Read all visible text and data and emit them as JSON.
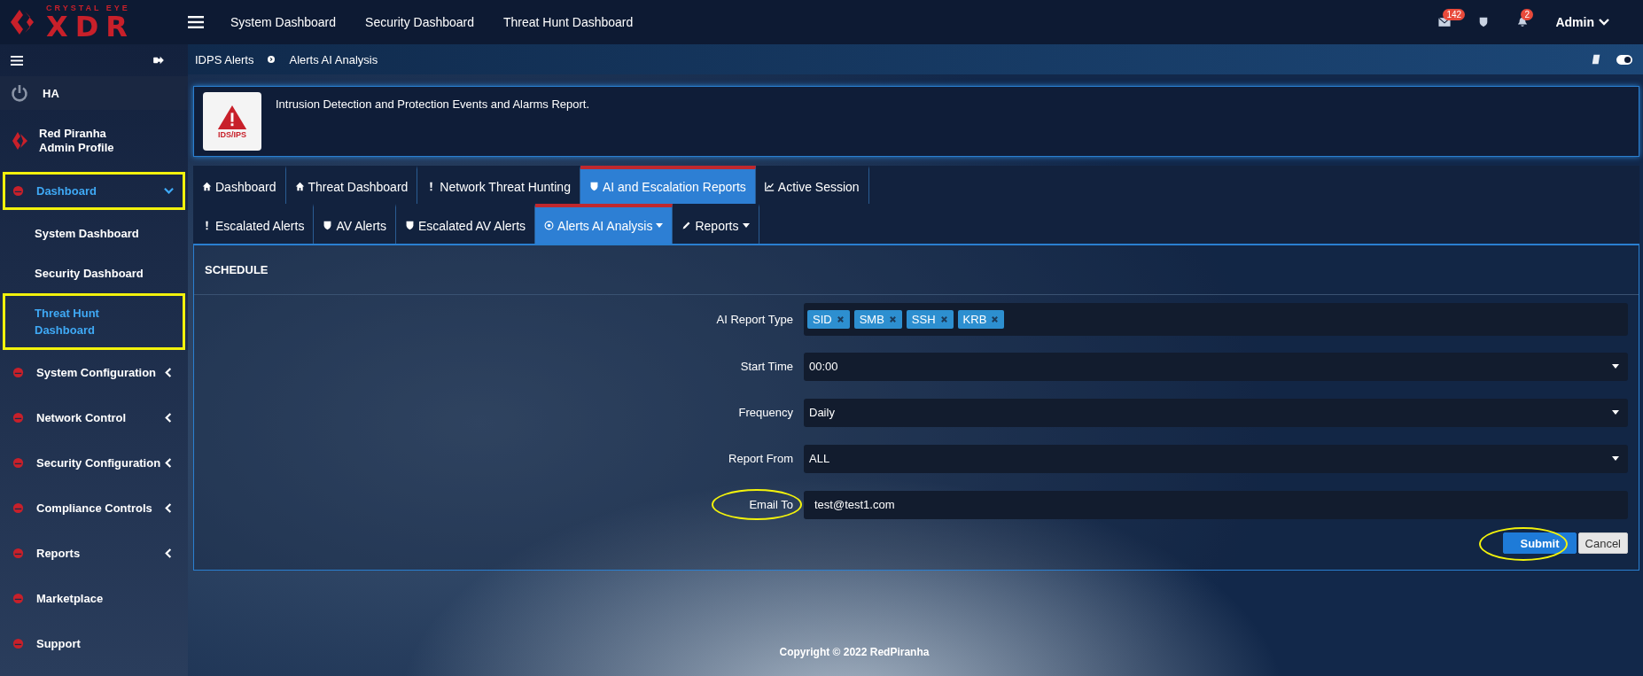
{
  "logo": {
    "tagline": "CRYSTAL EYE",
    "wordmark": "XDR"
  },
  "top_nav": [
    "System Dashboard",
    "Security Dashboard",
    "Threat Hunt Dashboard"
  ],
  "top_icons": {
    "mail_badge": "142",
    "bell_badge": "2",
    "user": "Admin"
  },
  "sidebar": {
    "ha": "HA",
    "profile": {
      "name": "Red Piranha",
      "role": "Admin Profile"
    },
    "items": [
      {
        "label": "Dashboard",
        "kind": "group",
        "expanded": true,
        "selected": true,
        "highlighted": true,
        "children": [
          {
            "label": "System Dashboard",
            "selected": false,
            "highlighted": false
          },
          {
            "label": "Security Dashboard",
            "selected": false,
            "highlighted": false
          },
          {
            "label": "Threat Hunt Dashboard",
            "selected": true,
            "highlighted": true
          }
        ]
      },
      {
        "label": "System Configuration",
        "kind": "group",
        "expanded": false,
        "selected": false,
        "highlighted": false
      },
      {
        "label": "Network Control",
        "kind": "group",
        "expanded": false,
        "selected": false,
        "highlighted": false
      },
      {
        "label": "Security Configuration",
        "kind": "group",
        "expanded": false,
        "selected": false,
        "highlighted": false
      },
      {
        "label": "Compliance Controls",
        "kind": "group",
        "expanded": false,
        "selected": false,
        "highlighted": false
      },
      {
        "label": "Reports",
        "kind": "group",
        "expanded": false,
        "selected": false,
        "highlighted": false
      },
      {
        "label": "Marketplace",
        "kind": "link",
        "expanded": false,
        "selected": false,
        "highlighted": false
      },
      {
        "label": "Support",
        "kind": "link",
        "expanded": false,
        "selected": false,
        "highlighted": false
      }
    ]
  },
  "breadcrumb": [
    "IDPS Alerts",
    "Alerts AI Analysis"
  ],
  "info": {
    "badge": "IDS/IPS",
    "text": "Intrusion Detection and Protection Events and Alarms Report."
  },
  "tabs": [
    {
      "label": "Dashboard",
      "selected": false
    },
    {
      "label": "Threat Dashboard",
      "selected": false
    },
    {
      "label": "Network Threat Hunting",
      "selected": false
    },
    {
      "label": "AI and Escalation Reports",
      "selected": true
    },
    {
      "label": "Active Session",
      "selected": false
    }
  ],
  "subtabs": [
    {
      "label": "Escalated Alerts",
      "selected": false,
      "dropdown": false
    },
    {
      "label": "AV Alerts",
      "selected": false,
      "dropdown": false
    },
    {
      "label": "Escalated AV Alerts",
      "selected": false,
      "dropdown": false
    },
    {
      "label": "Alerts AI Analysis",
      "selected": true,
      "dropdown": true
    },
    {
      "label": "Reports",
      "selected": false,
      "dropdown": true
    }
  ],
  "form": {
    "title": "SCHEDULE",
    "fields": [
      {
        "kind": "tags",
        "label": "AI Report Type",
        "tags": [
          "SID",
          "SMB",
          "SSH",
          "KRB"
        ],
        "circled": false
      },
      {
        "kind": "select",
        "label": "Start Time",
        "value": "00:00",
        "circled": false
      },
      {
        "kind": "select",
        "label": "Frequency",
        "value": "Daily",
        "circled": false
      },
      {
        "kind": "select",
        "label": "Report From",
        "value": "ALL",
        "circled": false
      },
      {
        "kind": "text",
        "label": "Email To",
        "value": "test@test1.com",
        "circled": true
      }
    ],
    "buttons": [
      {
        "label": "Submit",
        "kind": "primary",
        "circled": true
      },
      {
        "label": "Cancel",
        "kind": "default",
        "circled": false
      }
    ]
  },
  "footer": "Copyright © 2022 RedPiranha"
}
